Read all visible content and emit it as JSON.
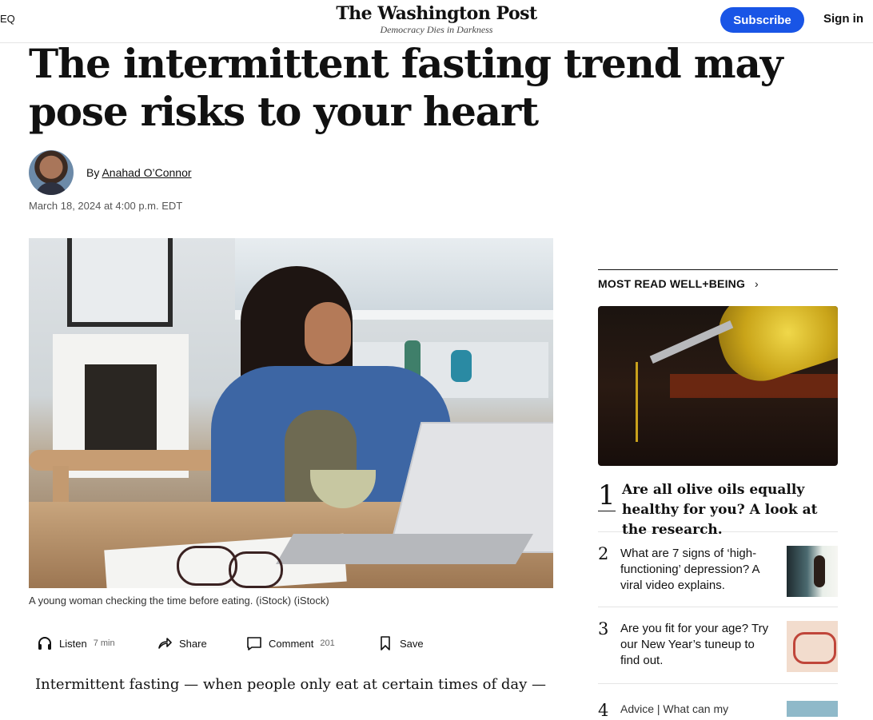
{
  "header": {
    "menu_stub": "EQ",
    "logo_name": "The Washington Post",
    "logo_tagline": "Democracy Dies in Darkness",
    "subscribe_label": "Subscribe",
    "signin_label": "Sign in",
    "accent_color": "#1955e6"
  },
  "article": {
    "headline": "The intermittent fasting trend may pose risks to your heart",
    "by_prefix": "By",
    "author": "Anahad O’Connor",
    "date": "March 18, 2024 at 4:00 p.m. EDT",
    "image_caption": "A young woman checking the time before eating. (iStock) (iStock)",
    "body_first_line": "Intermittent fasting — when people only eat at certain times of day —"
  },
  "actions": {
    "listen_label": "Listen",
    "listen_meta": "7 min",
    "share_label": "Share",
    "comment_label": "Comment",
    "comment_count": "201",
    "save_label": "Save",
    "icons": [
      "headphones-icon",
      "share-icon",
      "comment-icon",
      "bookmark-icon"
    ]
  },
  "sidebar": {
    "title": "MOST READ WELL+BEING",
    "chevron": "›",
    "items": [
      {
        "num": "1",
        "title": "Are all olive oils equally healthy for you? A look at the research."
      },
      {
        "num": "2",
        "title": "What are 7 signs of ‘high-functioning’ depression? A viral video explains."
      },
      {
        "num": "3",
        "title": "Are you fit for your age? Try our New Year’s tuneup to find out."
      },
      {
        "num": "4",
        "title": "Advice | What can my"
      }
    ]
  }
}
